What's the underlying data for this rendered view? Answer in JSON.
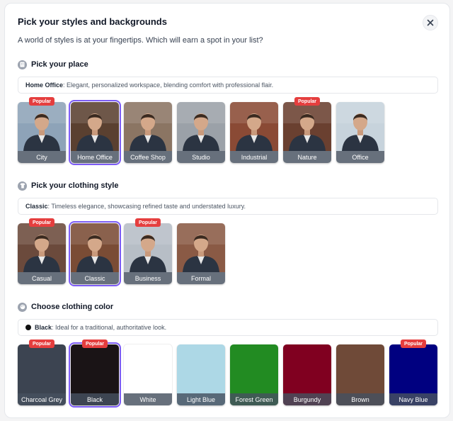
{
  "dialog": {
    "title": "Pick your styles and backgrounds",
    "subtitle": "A world of styles is at your fingertips. Which will earn a spot in your list?",
    "close_icon": "close-icon"
  },
  "badge_label": "Popular",
  "place": {
    "title": "Pick your place",
    "icon": "building-icon",
    "selected_name": "Home Office",
    "selected_desc": ": Elegant, personalized workspace, blending comfort with professional flair.",
    "options": [
      {
        "label": "City",
        "popular": true,
        "bg": "#8ea3b8"
      },
      {
        "label": "Home Office",
        "popular": false,
        "selected": true,
        "bg": "#5a4030"
      },
      {
        "label": "Coffee Shop",
        "popular": false,
        "bg": "#8b7563"
      },
      {
        "label": "Studio",
        "popular": false,
        "bg": "#9ba1a8"
      },
      {
        "label": "Industrial",
        "popular": false,
        "bg": "#8a4a35"
      },
      {
        "label": "Nature",
        "popular": true,
        "bg": "#6a4030"
      },
      {
        "label": "Office",
        "popular": false,
        "bg": "#c7d3dc"
      }
    ]
  },
  "clothing": {
    "title": "Pick your clothing style",
    "icon": "shirt-icon",
    "selected_name": "Classic",
    "selected_desc": ": Timeless elegance, showcasing refined taste and understated luxury.",
    "options": [
      {
        "label": "Casual",
        "popular": true,
        "bg": "#6b4a3c"
      },
      {
        "label": "Classic",
        "popular": false,
        "selected": true,
        "bg": "#7a4c35"
      },
      {
        "label": "Business",
        "popular": true,
        "bg": "#b7bec6"
      },
      {
        "label": "Formal",
        "popular": false,
        "bg": "#8a5a45"
      }
    ]
  },
  "color": {
    "title": "Choose clothing color",
    "icon": "palette-icon",
    "selected_name": "Black",
    "selected_desc": ": Ideal for a traditional, authoritative look.",
    "options": [
      {
        "label": "Charcoal Grey",
        "popular": true,
        "hex": "#3c4451"
      },
      {
        "label": "Black",
        "popular": true,
        "selected": true,
        "hex": "#1a1416"
      },
      {
        "label": "White",
        "popular": false,
        "hex": "#ffffff"
      },
      {
        "label": "Light Blue",
        "popular": false,
        "hex": "#add8e6"
      },
      {
        "label": "Forest Green",
        "popular": false,
        "hex": "#228b22"
      },
      {
        "label": "Burgundy",
        "popular": false,
        "hex": "#800020"
      },
      {
        "label": "Brown",
        "popular": false,
        "hex": "#6f4a38"
      },
      {
        "label": "Navy Blue",
        "popular": true,
        "hex": "#000080"
      }
    ]
  },
  "accent_color": "#7c5cf5",
  "badge_color": "#e53e3e"
}
